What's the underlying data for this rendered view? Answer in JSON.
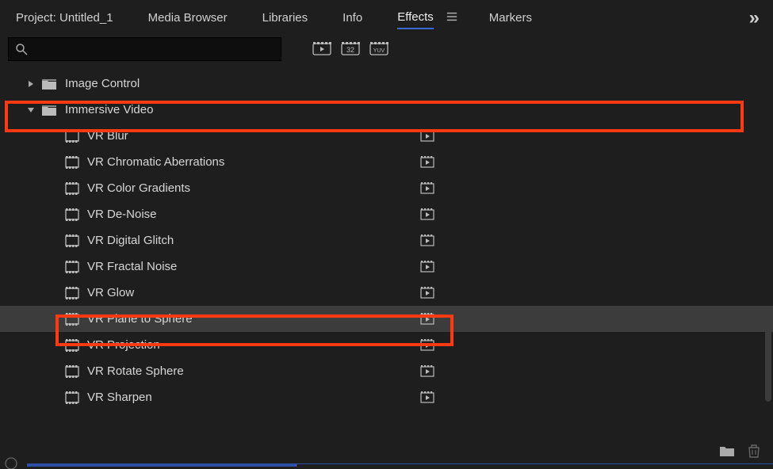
{
  "tabs": {
    "items": [
      {
        "label": "Project: Untitled_1",
        "active": false
      },
      {
        "label": "Media Browser",
        "active": false
      },
      {
        "label": "Libraries",
        "active": false
      },
      {
        "label": "Info",
        "active": false
      },
      {
        "label": "Effects",
        "active": true
      },
      {
        "label": "Markers",
        "active": false
      }
    ]
  },
  "search": {
    "value": ""
  },
  "toolbar": {
    "btn1": "FX-accel",
    "btn2": "32-bit",
    "btn3": "YUV"
  },
  "tree": [
    {
      "type": "folder",
      "label": "Image Control",
      "expanded": false,
      "level": 1,
      "highlight": false
    },
    {
      "type": "folder",
      "label": "Immersive Video",
      "expanded": true,
      "level": 1,
      "highlight": true
    },
    {
      "type": "effect",
      "label": "VR Blur",
      "level": 2
    },
    {
      "type": "effect",
      "label": "VR Chromatic Aberrations",
      "level": 2
    },
    {
      "type": "effect",
      "label": "VR Color Gradients",
      "level": 2
    },
    {
      "type": "effect",
      "label": "VR De-Noise",
      "level": 2
    },
    {
      "type": "effect",
      "label": "VR Digital Glitch",
      "level": 2
    },
    {
      "type": "effect",
      "label": "VR Fractal Noise",
      "level": 2
    },
    {
      "type": "effect",
      "label": "VR Glow",
      "level": 2
    },
    {
      "type": "effect",
      "label": "VR Plane to Sphere",
      "level": 2,
      "selected": true,
      "highlight": true
    },
    {
      "type": "effect",
      "label": "VR Projection",
      "level": 2
    },
    {
      "type": "effect",
      "label": "VR Rotate Sphere",
      "level": 2
    },
    {
      "type": "effect",
      "label": "VR Sharpen",
      "level": 2
    }
  ],
  "footer": {
    "new_bin": "New Bin",
    "delete": "Delete"
  }
}
